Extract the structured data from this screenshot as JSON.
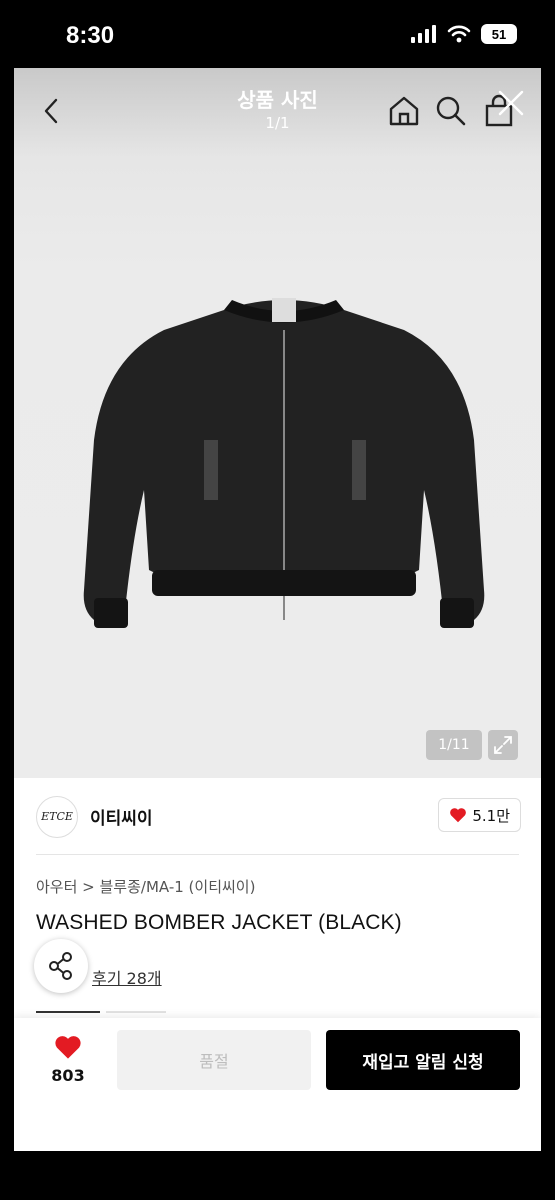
{
  "status": {
    "time": "8:30",
    "battery": "51"
  },
  "header": {
    "title": "상품 사진",
    "counter": "1/1"
  },
  "gallery": {
    "indicator": "1/11"
  },
  "brand": {
    "logo_text": "ETCE",
    "name": "이티씨이",
    "likes": "5.1만"
  },
  "product": {
    "breadcrumb": "아우터 > 블루종/MA-1 (이티씨이)",
    "name": "WASHED BOMBER JACKET (BLACK)",
    "reviews": "후기 28개"
  },
  "bottom": {
    "wish_count": "803",
    "soldout_label": "품절",
    "restock_label": "재입고 알림 신청"
  },
  "colors": {
    "heart": "#e31b23",
    "primary_button": "#000000",
    "disabled_button": "#f1f1f1"
  },
  "icons": [
    "back-icon",
    "home-icon",
    "search-icon",
    "cart-icon",
    "close-icon",
    "expand-icon",
    "share-icon",
    "heart-icon"
  ]
}
